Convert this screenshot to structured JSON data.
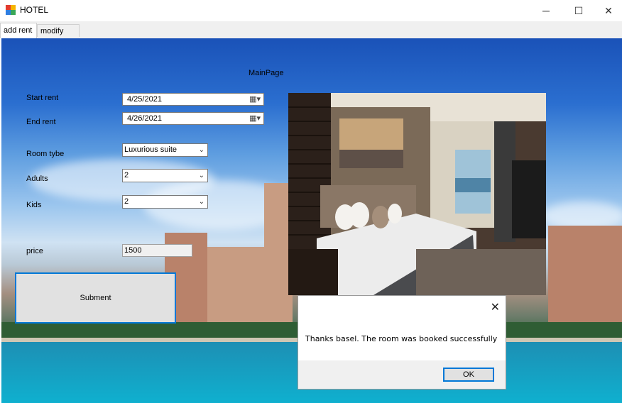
{
  "window": {
    "title": "HOTEL",
    "minimize_glyph": "─",
    "maximize_glyph": "☐",
    "close_glyph": "✕"
  },
  "tabs": [
    {
      "label": "add rent",
      "active": true
    },
    {
      "label": "modify rent",
      "active": false
    }
  ],
  "form": {
    "heading": "MainPage",
    "start_label": "Start rent",
    "start_value": "4/25/2021",
    "end_label": "End rent",
    "end_value": "4/26/2021",
    "room_label": "Room tybe",
    "room_value": "Luxurious suite",
    "adults_label": "Adults",
    "adults_value": "2",
    "kids_label": "Kids",
    "kids_value": "2",
    "price_label": "price",
    "price_value": "1500",
    "submit_label": "Subment"
  },
  "dialog": {
    "message": "Thanks basel. The room was booked successfully",
    "ok_label": "OK",
    "close_glyph": "✕"
  },
  "icons": {
    "calendar": "calendar-icon",
    "dropdown": "chevron-down-icon"
  },
  "colors": {
    "accent": "#0078d7",
    "button_face": "#e1e1e1",
    "dialog_footer": "#f0f0f0"
  }
}
